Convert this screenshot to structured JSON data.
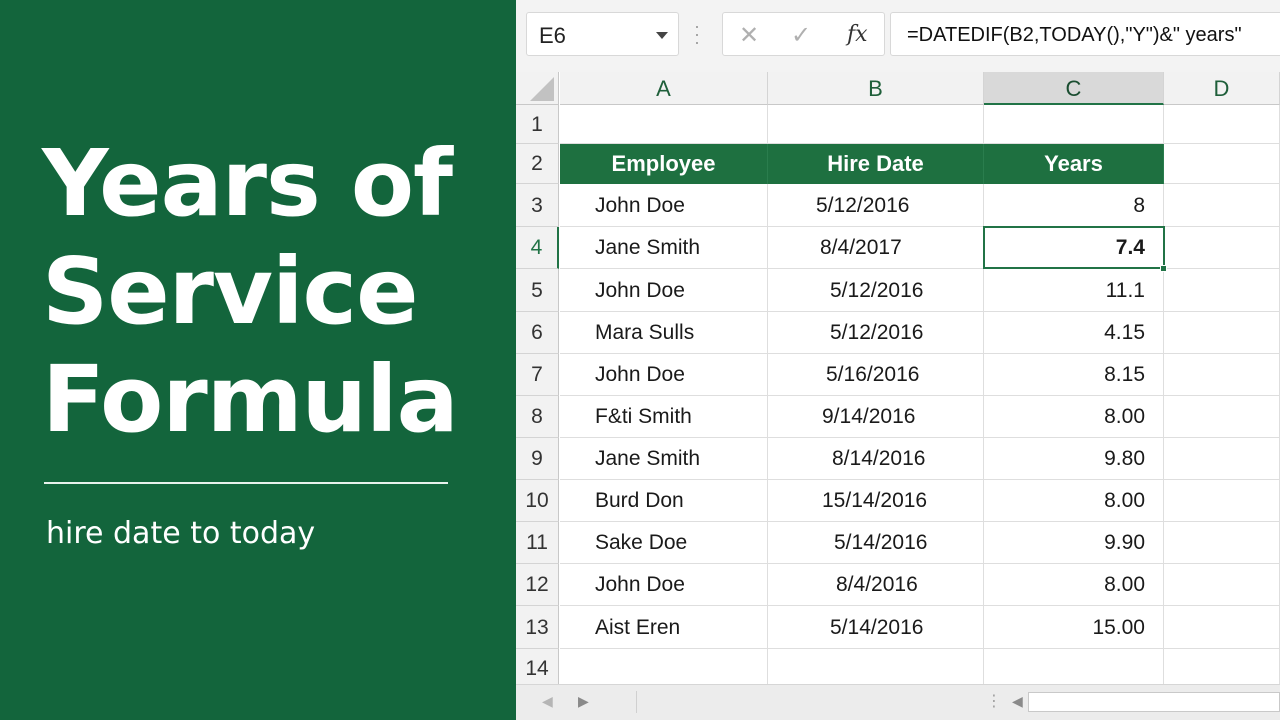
{
  "banner": {
    "title_lines": [
      "Years of",
      "Service",
      "Formula"
    ],
    "subtitle": "hire date to today"
  },
  "formula_bar": {
    "name_box": "E6",
    "cancel_icon": "x-icon",
    "enter_icon": "check-icon",
    "function_label": "fx",
    "formula": "=DATEDIF(B2,TODAY(),\"Y\")&\" years\""
  },
  "sheet": {
    "columns": [
      "A",
      "B",
      "C",
      "D"
    ],
    "selected_column": "C",
    "rows": [
      "1",
      "2",
      "3",
      "4",
      "5",
      "6",
      "7",
      "8",
      "9",
      "10",
      "11",
      "12",
      "13",
      "14"
    ],
    "active_row": "4",
    "headers": [
      "Employee",
      "Hire Date",
      "Years"
    ],
    "data": [
      {
        "name": "John Doe",
        "date": "5/12/2016",
        "years": "8"
      },
      {
        "name": "Jane Smith",
        "date": "8/4/2017",
        "years": "7.4"
      },
      {
        "name": "John Doe",
        "date": "5/12/2016",
        "years": "11.1"
      },
      {
        "name": "Mara Sulls",
        "date": "5/12/2016",
        "years": "4.15"
      },
      {
        "name": "John Doe",
        "date": "5/16/2016",
        "years": "8.15"
      },
      {
        "name": "F&ti Smith",
        "date": "9/14/2016",
        "years": "8.00"
      },
      {
        "name": "Jane Smith",
        "date": "8/14/2016",
        "years": "9.80"
      },
      {
        "name": "Burd Don",
        "date": "15/14/2016",
        "years": "8.00"
      },
      {
        "name": "Sake Doe",
        "date": "5/14/2016",
        "years": "9.90"
      },
      {
        "name": "John Doe",
        "date": "8/4/2016",
        "years": "8.00"
      },
      {
        "name": "Aist Eren",
        "date": "5/14/2016",
        "years": "15.00"
      }
    ]
  },
  "colors": {
    "banner_bg": "#13653c",
    "header_fill": "#1e7040",
    "selection": "#217346"
  }
}
